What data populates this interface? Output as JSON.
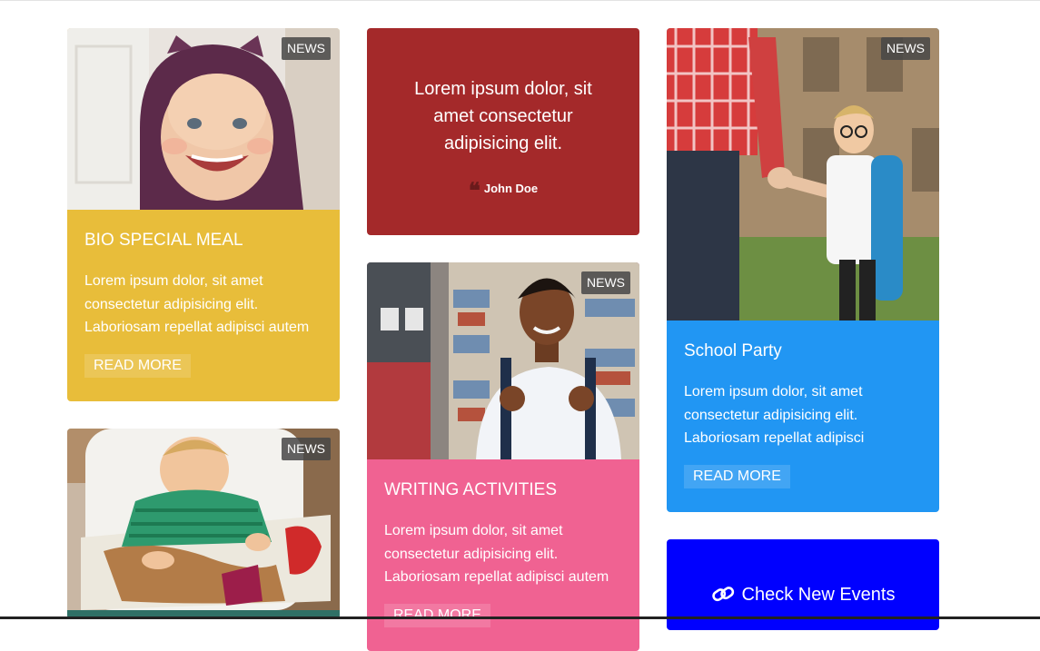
{
  "cards": [
    {
      "badge": "NEWS",
      "title": "BIO SPECIAL MEAL",
      "text": "Lorem ipsum dolor, sit amet consectetur adipisicing elit. Laboriosam repellat adipisci autem",
      "button": "READ MORE",
      "color": "#e8bd3a"
    },
    {
      "badge": "NEWS",
      "title": "WRITING ACTIVITIES",
      "text": "Lorem ipsum dolor, sit amet consectetur adipisicing elit. Laboriosam repellat adipisci autem",
      "button": "READ MORE",
      "color": "#f06292"
    },
    {
      "badge": "NEWS",
      "title": "School Party",
      "text": "Lorem ipsum dolor, sit amet consectetur adipisicing elit. Laboriosam repellat adipisci",
      "button": "READ MORE",
      "color": "#2196f3"
    },
    {
      "badge": "NEWS"
    }
  ],
  "quote": {
    "text": "Lorem ipsum dolor, sit amet consectetur adipisicing elit.",
    "author": "John Doe",
    "color": "#a4292a"
  },
  "events": {
    "label": "Check New Events",
    "icon": "link-icon",
    "color": "#0000ff"
  }
}
